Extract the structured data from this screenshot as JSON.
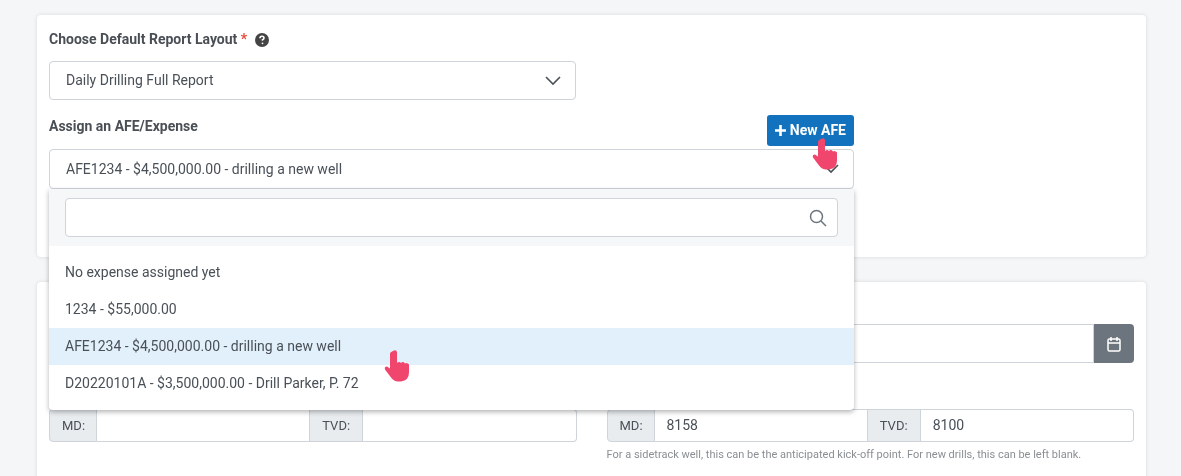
{
  "report_layout": {
    "label": "Choose Default Report Layout",
    "required_mark": "*",
    "value": "Daily Drilling Full Report"
  },
  "afe": {
    "label": "Assign an AFE/Expense",
    "new_button": "New AFE",
    "value": "AFE1234 - $4,500,000.00 - drilling a new well",
    "options": [
      {
        "label": "No expense assigned yet",
        "selected": false
      },
      {
        "label": "1234 - $55,000.00",
        "selected": false
      },
      {
        "label": "AFE1234 - $4,500,000.00 - drilling a new well",
        "selected": true
      },
      {
        "label": "D20220101A - $3,500,000.00 - Drill Parker, P. 72",
        "selected": false
      }
    ]
  },
  "depths": [
    {
      "md_label": "MD:",
      "tvd_label": "TVD:"
    },
    {
      "md_label": "MD:",
      "md_value": "8158",
      "tvd_label": "TVD:",
      "tvd_value": "8100",
      "help": "For a sidetrack well, this can be the anticipated kick-off point. For new drills, this can be left blank."
    }
  ]
}
